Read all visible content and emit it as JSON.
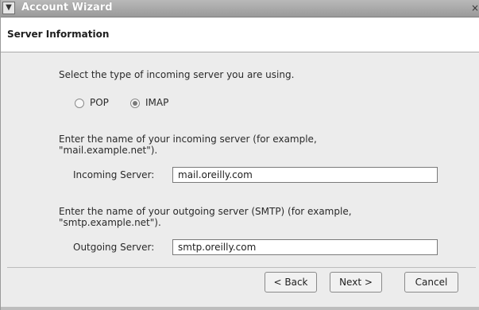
{
  "window": {
    "title": "Account Wizard",
    "menu_icon": "chevron-down-icon",
    "close_icon": "close-icon"
  },
  "page": {
    "title": "Server Information"
  },
  "incoming_type": {
    "prompt": "Select the type of incoming server you are using.",
    "options": [
      {
        "label": "POP",
        "selected": false
      },
      {
        "label": "IMAP",
        "selected": true
      }
    ]
  },
  "incoming": {
    "instruction_line1": "Enter the name of your incoming server (for example,",
    "instruction_line2": "\"mail.example.net\").",
    "label": "Incoming Server:",
    "value": "mail.oreilly.com"
  },
  "outgoing": {
    "instruction_line1": "Enter the name of your outgoing server (SMTP) (for example,",
    "instruction_line2": "\"smtp.example.net\").",
    "label": "Outgoing Server:",
    "value": "smtp.oreilly.com"
  },
  "buttons": {
    "back": "< Back",
    "next": "Next >",
    "cancel": "Cancel"
  }
}
